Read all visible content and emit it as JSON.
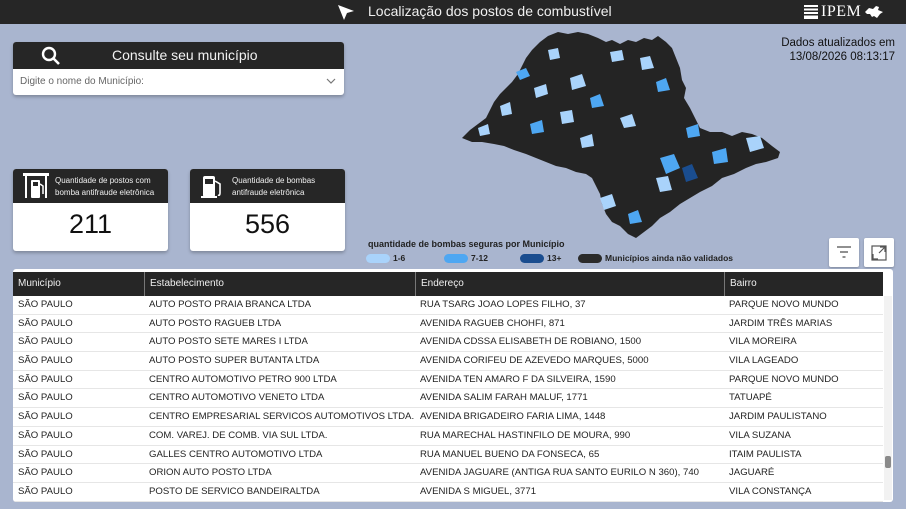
{
  "header": {
    "title": "Localização dos postos de combustível",
    "logo_text": "IPEM",
    "cursor_icon": "cursor-arrow-icon",
    "flag_icon": "sp-flag-icon"
  },
  "search": {
    "title": "Consulte seu município",
    "placeholder": "Digite o nome do Município:",
    "icon": "search-icon",
    "dropdown_icon": "chevron-down-icon"
  },
  "updated": {
    "line1": "Dados atualizados em",
    "line2": "13/08/2026 08:13:17"
  },
  "kpis": [
    {
      "label": "Quantidade de postos com bomba antifraude eletrônica",
      "value": "211",
      "icon": "gas-station-icon"
    },
    {
      "label": "Quantidade de bombas antifraude eletrônica",
      "value": "556",
      "icon": "fuel-pump-icon"
    }
  ],
  "legend": {
    "title": "quantidade de bombas seguras por Município",
    "items": [
      {
        "label": "1-6",
        "color": "#a9d3fb"
      },
      {
        "label": "7-12",
        "color": "#4ea7f2"
      },
      {
        "label": "13+",
        "color": "#1a4d8f"
      },
      {
        "label": "Municípios ainda não validados",
        "color": "#2b2b2b"
      }
    ]
  },
  "map": {
    "title": "São Paulo municipalities map",
    "colors": {
      "unvalidated": "#242424",
      "low": "#a9d3fb",
      "mid": "#4ea7f2",
      "high": "#1a4d8f"
    }
  },
  "toolbar": {
    "filter_icon": "filter-icon",
    "expand_icon": "expand-icon"
  },
  "table": {
    "columns": [
      "Município",
      "Estabelecimento",
      "Endereço",
      "Bairro"
    ],
    "rows": [
      [
        "SÃO PAULO",
        "AUTO POSTO PRAIA BRANCA LTDA",
        "RUA TSARG JOAO LOPES FILHO, 37",
        "PARQUE NOVO MUNDO"
      ],
      [
        "SÃO PAULO",
        "AUTO POSTO RAGUEB LTDA",
        "AVENIDA RAGUEB CHOHFI, 871",
        "JARDIM TRÊS MARIAS"
      ],
      [
        "SÃO PAULO",
        "AUTO POSTO SETE MARES I LTDA",
        "AVENIDA CDSSA ELISABETH DE ROBIANO, 1500",
        "VILA MOREIRA"
      ],
      [
        "SÃO PAULO",
        "AUTO POSTO SUPER BUTANTA LTDA",
        "AVENIDA CORIFEU DE AZEVEDO MARQUES, 5000",
        "VILA LAGEADO"
      ],
      [
        "SÃO PAULO",
        "CENTRO AUTOMOTIVO PETRO 900 LTDA",
        "AVENIDA TEN AMARO F DA SILVEIRA, 1590",
        "PARQUE NOVO MUNDO"
      ],
      [
        "SÃO PAULO",
        "CENTRO AUTOMOTIVO VENETO LTDA",
        "AVENIDA SALIM FARAH MALUF, 1771",
        "TATUAPÉ"
      ],
      [
        "SÃO PAULO",
        "CENTRO EMPRESARIAL SERVICOS AUTOMOTIVOS LTDA.",
        "AVENIDA BRIGADEIRO FARIA LIMA, 1448",
        "JARDIM PAULISTANO"
      ],
      [
        "SÃO PAULO",
        "COM. VAREJ. DE COMB. VIA SUL LTDA.",
        "RUA MARECHAL HASTINFILO DE MOURA, 990",
        "VILA SUZANA"
      ],
      [
        "SÃO PAULO",
        "GALLES CENTRO AUTOMOTIVO LTDA",
        "RUA MANUEL BUENO DA FONSECA, 65",
        "ITAIM PAULISTA"
      ],
      [
        "SÃO PAULO",
        "ORION AUTO POSTO LTDA",
        "AVENIDA JAGUARE (ANTIGA RUA SANTO EURILO N 360), 740",
        "JAGUARÉ"
      ],
      [
        "SÃO PAULO",
        "POSTO DE SERVICO BANDEIRALTDA",
        "AVENIDA S MIGUEL, 3771",
        "VILA CONSTANÇA"
      ]
    ]
  }
}
